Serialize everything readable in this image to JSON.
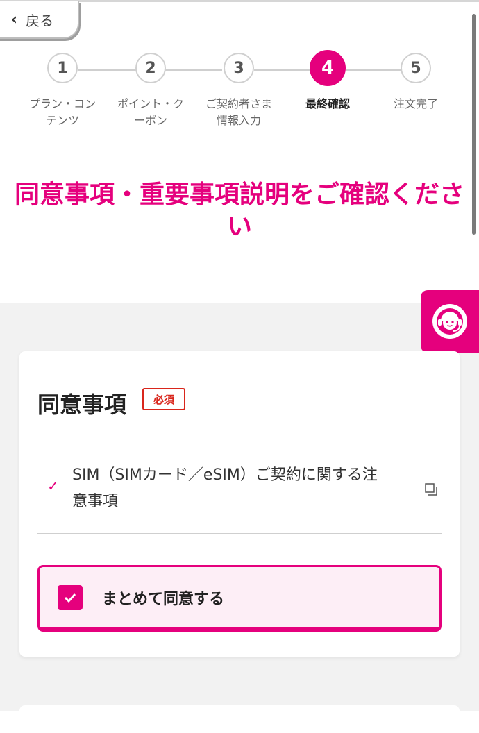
{
  "back": {
    "label": "戻る"
  },
  "steps": [
    {
      "num": "1",
      "label": "プラン・コン\nテンツ"
    },
    {
      "num": "2",
      "label": "ポイント・ク\nーポン"
    },
    {
      "num": "3",
      "label": "ご契約者さま\n情報入力"
    },
    {
      "num": "4",
      "label": "最終確認"
    },
    {
      "num": "5",
      "label": "注文完了"
    }
  ],
  "current_step": 4,
  "headline": "同意事項・重要事項説明をご確認ください",
  "agreement": {
    "title": "同意事項",
    "required_badge": "必須",
    "item_text": "SIM（SIMカード／eSIM）ご契約に関する注意事項",
    "agree_all_label": "まとめて同意する",
    "agree_all_checked": true
  },
  "colors": {
    "accent": "#e5007d",
    "required": "#d9261c"
  },
  "icons": {
    "back": "chevron-left-icon",
    "support": "operator-headset-icon",
    "item_check": "checkmark-icon",
    "external": "external-window-icon",
    "agree_check": "checkbox-checked-icon"
  }
}
